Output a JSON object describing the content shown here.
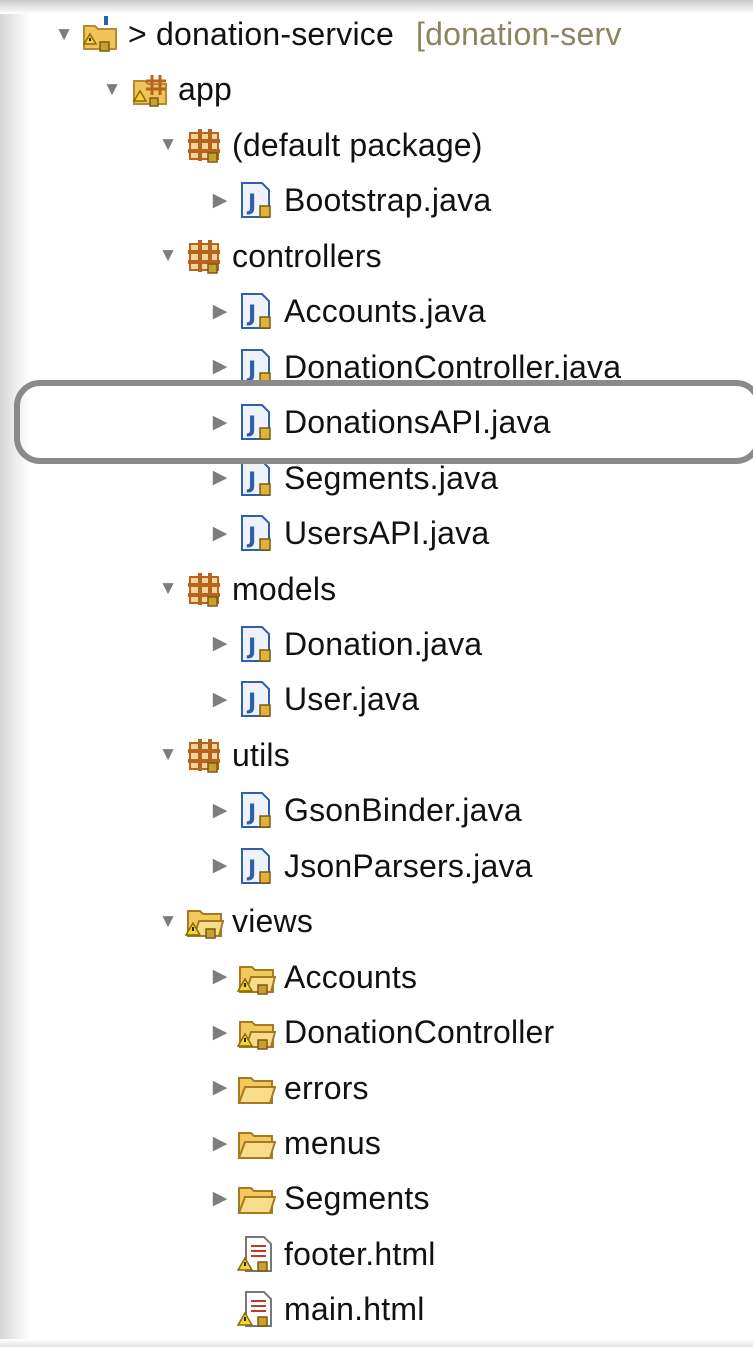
{
  "tree": {
    "project": {
      "label": "> donation-service",
      "hint": "[donation-serv"
    },
    "rows": [
      {
        "id": "app",
        "label": "app"
      },
      {
        "id": "default-package",
        "label": "(default package)"
      },
      {
        "id": "bootstrap",
        "label": "Bootstrap.java"
      },
      {
        "id": "controllers",
        "label": "controllers"
      },
      {
        "id": "accounts-java",
        "label": "Accounts.java"
      },
      {
        "id": "donationcontroller-java",
        "label": "DonationController.java"
      },
      {
        "id": "donationsapi-java",
        "label": "DonationsAPI.java"
      },
      {
        "id": "segments-java",
        "label": "Segments.java"
      },
      {
        "id": "usersapi-java",
        "label": "UsersAPI.java"
      },
      {
        "id": "models",
        "label": "models"
      },
      {
        "id": "donation-java",
        "label": "Donation.java"
      },
      {
        "id": "user-java",
        "label": "User.java"
      },
      {
        "id": "utils",
        "label": "utils"
      },
      {
        "id": "gsonbinder-java",
        "label": "GsonBinder.java"
      },
      {
        "id": "jsonparsers-java",
        "label": "JsonParsers.java"
      },
      {
        "id": "views",
        "label": "views"
      },
      {
        "id": "views-accounts",
        "label": "Accounts"
      },
      {
        "id": "views-donationcontroller",
        "label": "DonationController"
      },
      {
        "id": "views-errors",
        "label": "errors"
      },
      {
        "id": "views-menus",
        "label": "menus"
      },
      {
        "id": "views-segments",
        "label": "Segments"
      },
      {
        "id": "footer-html",
        "label": "footer.html"
      },
      {
        "id": "main-html",
        "label": "main.html"
      }
    ]
  },
  "highlighted_item": "DonationsAPI.java",
  "icons": {
    "project": "java-project-icon",
    "source-folder": "source-folder-icon",
    "package": "package-icon",
    "java-file": "java-file-icon",
    "folder": "folder-icon",
    "html-file": "html-file-icon"
  },
  "colors": {
    "highlight_ring": "#8a8a8a",
    "package": "#b5651d",
    "java_file": "#2f5fa8",
    "folder": "#e8b84a",
    "hint_text": "#8c8360"
  }
}
